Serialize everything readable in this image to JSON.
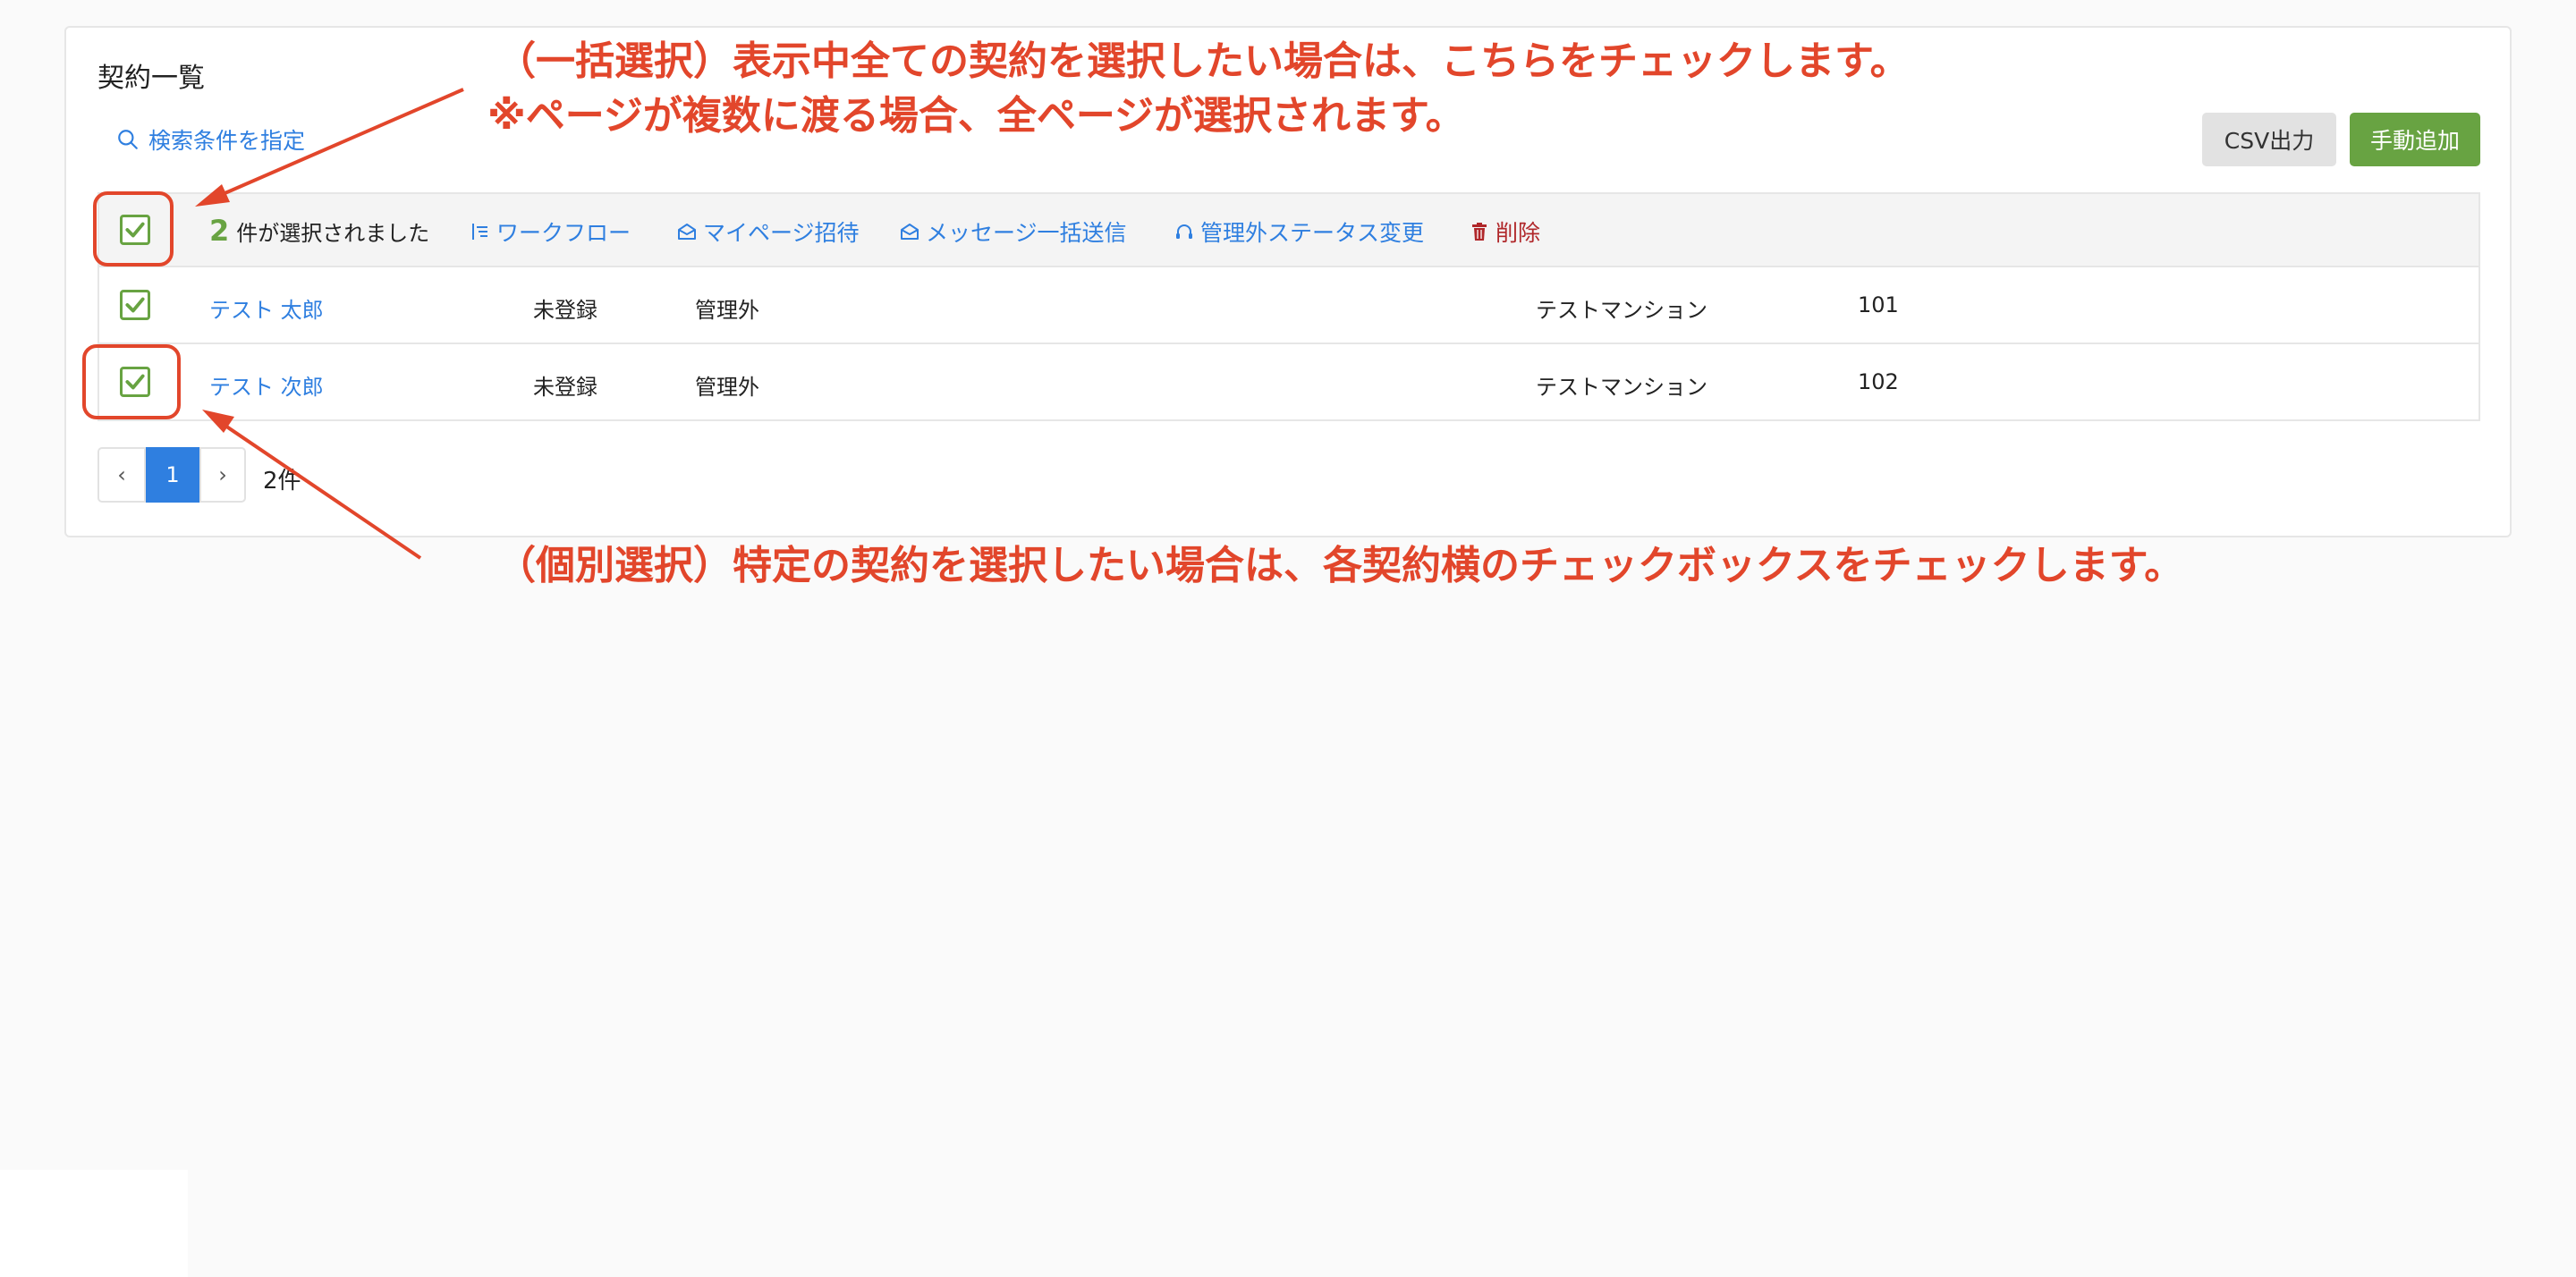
{
  "page": {
    "title": "契約一覧",
    "search_label": "検索条件を指定",
    "csv_button": "CSV出力",
    "add_button": "手動追加"
  },
  "selection": {
    "count": "2",
    "count_text": "件が選択されました"
  },
  "actions": [
    {
      "label": "ワークフロー",
      "icon": "workflow-icon"
    },
    {
      "label": "マイページ招待",
      "icon": "envelope-open-icon"
    },
    {
      "label": "メッセージ一括送信",
      "icon": "envelope-open-icon"
    },
    {
      "label": "管理外ステータス変更",
      "icon": "headset-icon"
    },
    {
      "label": "削除",
      "icon": "trash-icon"
    }
  ],
  "rows": [
    {
      "name": "テスト 太郎",
      "registration": "未登録",
      "status": "管理外",
      "building": "テストマンション",
      "room": "101",
      "checked": true
    },
    {
      "name": "テスト 次郎",
      "registration": "未登録",
      "status": "管理外",
      "building": "テストマンション",
      "room": "102",
      "checked": true
    }
  ],
  "pagination": {
    "prev": "‹",
    "current": "1",
    "next": "›",
    "total": "2件"
  },
  "annotations": {
    "bulk_line1": "（一括選択）表示中全ての契約を選択したい場合は、こちらをチェックします。",
    "bulk_line2": "※ページが複数に渡る場合、全ページが選択されます。",
    "individual": "（個別選択）特定の契約を選択したい場合は、各契約横のチェックボックスをチェックします。"
  },
  "colors": {
    "accent_green": "#68a342",
    "link_blue": "#2f7fe0",
    "annotation_red": "#e2462b",
    "delete_red": "#b0272a"
  }
}
